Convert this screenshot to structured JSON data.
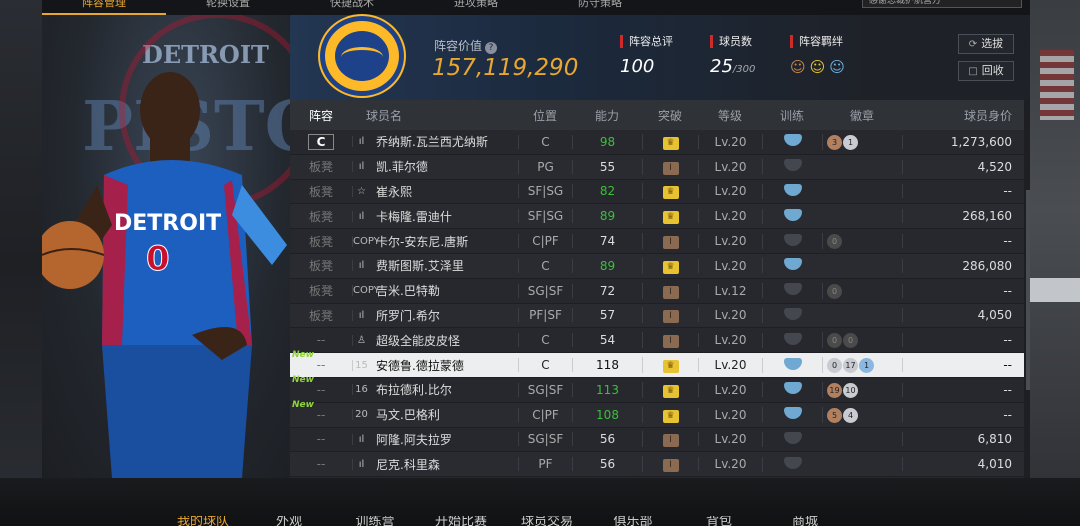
{
  "top_tabs": [
    "阵容管理",
    "轮换设置",
    "快捷战术",
    "进攻策略",
    "防守策略"
  ],
  "top_select": "感谢总裁护航营方",
  "header": {
    "lineup_value_label": "阵容价值",
    "lineup_value": "157,119,290",
    "stats": [
      {
        "label": "阵容总评",
        "value": "100"
      },
      {
        "label": "球员数",
        "value": "25",
        "suffix": "/300"
      },
      {
        "label": "阵容羁绊",
        "value": ""
      }
    ],
    "buttons": {
      "select": "选拔",
      "recycle": "回收"
    }
  },
  "art": {
    "logo_top": "DETROIT",
    "logo_main": "PISTONS"
  },
  "table": {
    "headers": [
      "阵容",
      "球员名",
      "位置",
      "能力",
      "突破",
      "等级",
      "训练",
      "徽章",
      "球员身价"
    ],
    "rows": [
      {
        "lineup": "C",
        "icon": "ıl",
        "name": "乔纳斯.瓦兰西尤纳斯",
        "pos": "C",
        "ovr": "98",
        "green": true,
        "brk": "gold",
        "lvl": "Lv.20",
        "train": "blue",
        "badges": [
          [
            "br",
            "3"
          ],
          [
            "sv",
            "1"
          ]
        ],
        "price": "1,273,600"
      },
      {
        "lineup": "板凳",
        "icon": "ıl",
        "name": "凯.菲尔德",
        "pos": "PG",
        "ovr": "55",
        "green": false,
        "brk": "brown",
        "lvl": "Lv.20",
        "train": "gray",
        "badges": [],
        "price": "4,520"
      },
      {
        "lineup": "板凳",
        "icon": "☆",
        "name": "崔永熙",
        "pos": "SF|SG",
        "ovr": "82",
        "green": true,
        "brk": "gold",
        "lvl": "Lv.20",
        "train": "blue",
        "badges": [],
        "price": "--"
      },
      {
        "lineup": "板凳",
        "icon": "ıl",
        "name": "卡梅隆.雷迪什",
        "pos": "SF|SG",
        "ovr": "89",
        "green": true,
        "brk": "gold",
        "lvl": "Lv.20",
        "train": "blue",
        "badges": [],
        "price": "268,160"
      },
      {
        "lineup": "板凳",
        "icon": "COPY",
        "name": "卡尔-安东尼.唐斯",
        "pos": "C|PF",
        "ovr": "74",
        "green": false,
        "brk": "brown",
        "lvl": "Lv.20",
        "train": "gray",
        "badges": [
          [
            "dk",
            "0"
          ]
        ],
        "price": "--"
      },
      {
        "lineup": "板凳",
        "icon": "ıl",
        "name": "费斯图斯.艾泽里",
        "pos": "C",
        "ovr": "89",
        "green": true,
        "brk": "gold",
        "lvl": "Lv.20",
        "train": "blue",
        "badges": [],
        "price": "286,080"
      },
      {
        "lineup": "板凳",
        "icon": "COPY",
        "name": "吉米.巴特勒",
        "pos": "SG|SF",
        "ovr": "72",
        "green": false,
        "brk": "brown",
        "lvl": "Lv.12",
        "train": "gray",
        "badges": [
          [
            "dk",
            "0"
          ]
        ],
        "price": "--"
      },
      {
        "lineup": "板凳",
        "icon": "ıl",
        "name": "所罗门.希尔",
        "pos": "PF|SF",
        "ovr": "57",
        "green": false,
        "brk": "brown",
        "lvl": "Lv.20",
        "train": "gray",
        "badges": [],
        "price": "4,050"
      },
      {
        "lineup": "--",
        "icon": "♙",
        "name": "超级全能皮皮怪",
        "pos": "C",
        "ovr": "54",
        "green": false,
        "brk": "brown",
        "lvl": "Lv.20",
        "train": "gray",
        "badges": [
          [
            "dk",
            "0"
          ],
          [
            "dk",
            "0"
          ]
        ],
        "price": "--"
      },
      {
        "lineup": "--",
        "new": "New",
        "selected": true,
        "icon": "15",
        "name": "安德鲁.德拉蒙德",
        "pos": "C",
        "ovr": "118",
        "green": false,
        "brk": "gold",
        "lvl": "Lv.20",
        "train": "blue",
        "badges": [
          [
            "sv",
            "0"
          ],
          [
            "sv",
            "17"
          ],
          [
            "bl",
            "1"
          ]
        ],
        "price": "--"
      },
      {
        "lineup": "--",
        "new": "New",
        "icon": "16",
        "name": "布拉德利.比尔",
        "pos": "SG|SF",
        "ovr": "113",
        "green": true,
        "brk": "gold",
        "lvl": "Lv.20",
        "train": "blue",
        "badges": [
          [
            "br",
            "19"
          ],
          [
            "sv",
            "10"
          ]
        ],
        "price": "--"
      },
      {
        "lineup": "--",
        "new": "New",
        "icon": "20",
        "name": "马文.巴格利",
        "pos": "C|PF",
        "ovr": "108",
        "green": true,
        "brk": "gold",
        "lvl": "Lv.20",
        "train": "blue",
        "badges": [
          [
            "br",
            "5"
          ],
          [
            "sv",
            "4"
          ]
        ],
        "price": "--"
      },
      {
        "lineup": "--",
        "icon": "ıl",
        "name": "阿隆.阿夫拉罗",
        "pos": "SG|SF",
        "ovr": "56",
        "green": false,
        "brk": "brown",
        "lvl": "Lv.20",
        "train": "gray",
        "badges": [],
        "price": "6,810"
      },
      {
        "lineup": "--",
        "icon": "ıl",
        "name": "尼克.科里森",
        "pos": "PF",
        "ovr": "56",
        "green": false,
        "brk": "brown",
        "lvl": "Lv.20",
        "train": "gray",
        "badges": [],
        "price": "4,010"
      }
    ]
  },
  "bottom_nav": [
    "我的球队",
    "外观",
    "训练营",
    "开始比赛",
    "球员交易",
    "俱乐部",
    "背包",
    "商城"
  ]
}
